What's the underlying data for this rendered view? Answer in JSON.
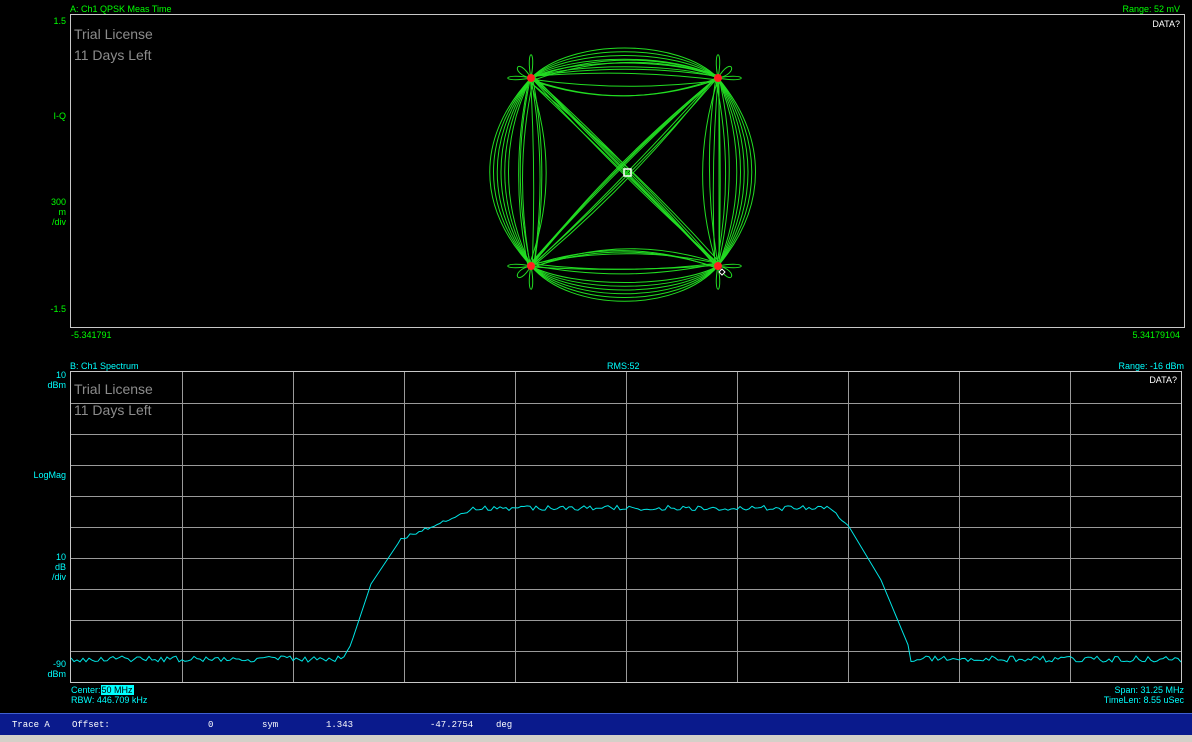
{
  "trace_a": {
    "title": "A: Ch1 QPSK Meas Time",
    "range": "Range: 52 mV",
    "data_query": "DATA?",
    "watermark_line1": "Trial License",
    "watermark_line2": "11 Days Left",
    "y_top": "1.5",
    "y_mid": "I-Q",
    "y_scale_value": "300",
    "y_scale_unit1": "m",
    "y_scale_unit2": "/div",
    "y_bottom": "-1.5",
    "x_left": "-5.341791",
    "x_right": "5.34179104",
    "trace_color": "#22dd22",
    "symbol_color": "#ff2020"
  },
  "trace_b": {
    "title": "B: Ch1 Spectrum",
    "rms": "RMS:52",
    "range": "Range: -16 dBm",
    "data_query": "DATA?",
    "watermark_line1": "Trial License",
    "watermark_line2": "11 Days Left",
    "y_top_value": "10",
    "y_top_unit": "dBm",
    "y_mid": "LogMag",
    "y_scale_value": "10",
    "y_scale_unit1": "dB",
    "y_scale_unit2": "/div",
    "y_bottom_value": "-90",
    "y_bottom_unit": "dBm",
    "center_label": "Center:",
    "center_value": "50 MHz",
    "rbw": "RBW: 446.709 kHz",
    "span": "Span: 31.25 MHz",
    "timelen": "TimeLen: 8.55 uSec",
    "trace_color": "#00e5e5"
  },
  "status_bar": {
    "trace": "Trace A",
    "offset_label": "Offset:",
    "offset_value": "0",
    "unit1": "sym",
    "value2": "1.343",
    "value3": "-47.2754",
    "unit2": "deg"
  }
}
